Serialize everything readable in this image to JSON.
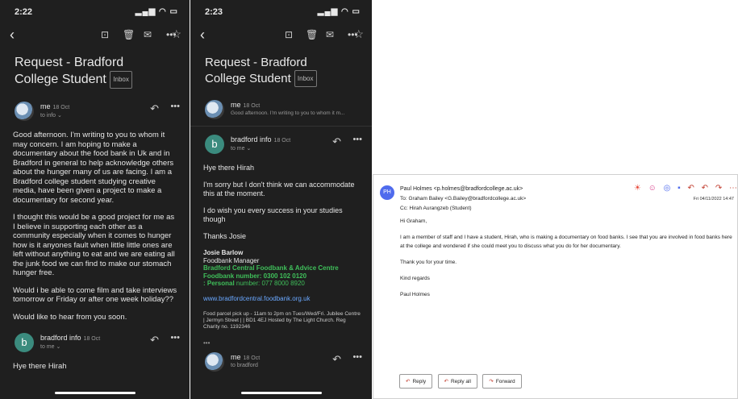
{
  "phone1": {
    "time": "2:22",
    "subject": "Request - Bradford College Student",
    "inbox_label": "Inbox",
    "sender": "me",
    "date": "18 Oct",
    "to": "to info ⌄",
    "body": [
      "Good afternoon. I'm writing to you to whom it may concern. I am hoping to make a documentary about the food bank in Uk and in Bradford in general to help acknowledge others about the hunger many of us are facing. I am a Bradford college student studying creative media, have been given a project to make a documentary for second year.",
      "I thought this would be a good project for me as I believe in supporting each other as a community especially when it comes to hunger how is it anyones fault when little little ones are left without anything to eat and we are eating all the junk food we can find to make our stomach hunger free.",
      "Would i be able to come film and take interviews tomorrow or Friday or after one week holiday??",
      "Would like to hear from you soon."
    ],
    "reply_sender": "bradford info",
    "reply_date": "18 Oct",
    "reply_to": "to me ⌄",
    "reply_preview": "Hye there Hirah"
  },
  "phone2": {
    "time": "2:23",
    "subject": "Request - Bradford College Student",
    "inbox_label": "Inbox",
    "me_sender": "me",
    "me_date": "18 Oct",
    "me_preview": "Good afternoon. I'm writing to you to whom it m...",
    "sender": "bradford info",
    "date": "18 Oct",
    "to": "to me ⌄",
    "greeting": "Hye there Hirah",
    "p1": "I'm sorry but I don't think we can accommodate this at the moment.",
    "p2": "I do wish you every success in your studies though",
    "thanks": "Thanks Josie",
    "sig_name": "Josie Barlow",
    "sig_title": "Foodbank Manager",
    "sig_org": "Bradford Central Foodbank & Advice Centre",
    "sig_number": "Foodbank number: 0300 102 0120",
    "sig_personal_label": ": Personal",
    "sig_personal": " number: 077 8000 8920",
    "sig_link": "www.bradfordcentral.foodbank.org.uk",
    "sig_small": "Food parcel pick up - 11am to 2pm on Tues/Wed/Fri. Jubilee Centre | Jermyn Street | | BD1 4EJ Hosted by The Light Church. Reg Charity no. 1192346",
    "ellipsis": "•••",
    "next_sender": "me",
    "next_date": "18 Oct",
    "next_to": "to bradford"
  },
  "desk": {
    "avatar": "PH",
    "from": "Paul Holmes <p.holmes@bradfordcollege.ac.uk>",
    "to": "To: Graham Bailey <G.Bailey@bradfordcollege.ac.uk>",
    "cc": "Cc: Hirah Aurangzeb (Student)",
    "date": "Fri 04/11/2022 14:47",
    "greeting": "Hi Graham,",
    "para": "I am a member of staff and I have a student, Hirah, who is making a documentary on food banks. I see that you are involved in food banks here at the college and wondered if she could meet you to discuss what you do for her documentary.",
    "thanks": "Thank you for your time.",
    "closing": "Kind regards",
    "name": "Paul Holmes",
    "reply": "Reply",
    "reply_all": "Reply all",
    "forward": "Forward"
  },
  "colors": {
    "phone_bg": "#1f1f1f",
    "green": "#3fbf5a",
    "link": "#6aa8ff",
    "accent_red": "#c0392b"
  }
}
